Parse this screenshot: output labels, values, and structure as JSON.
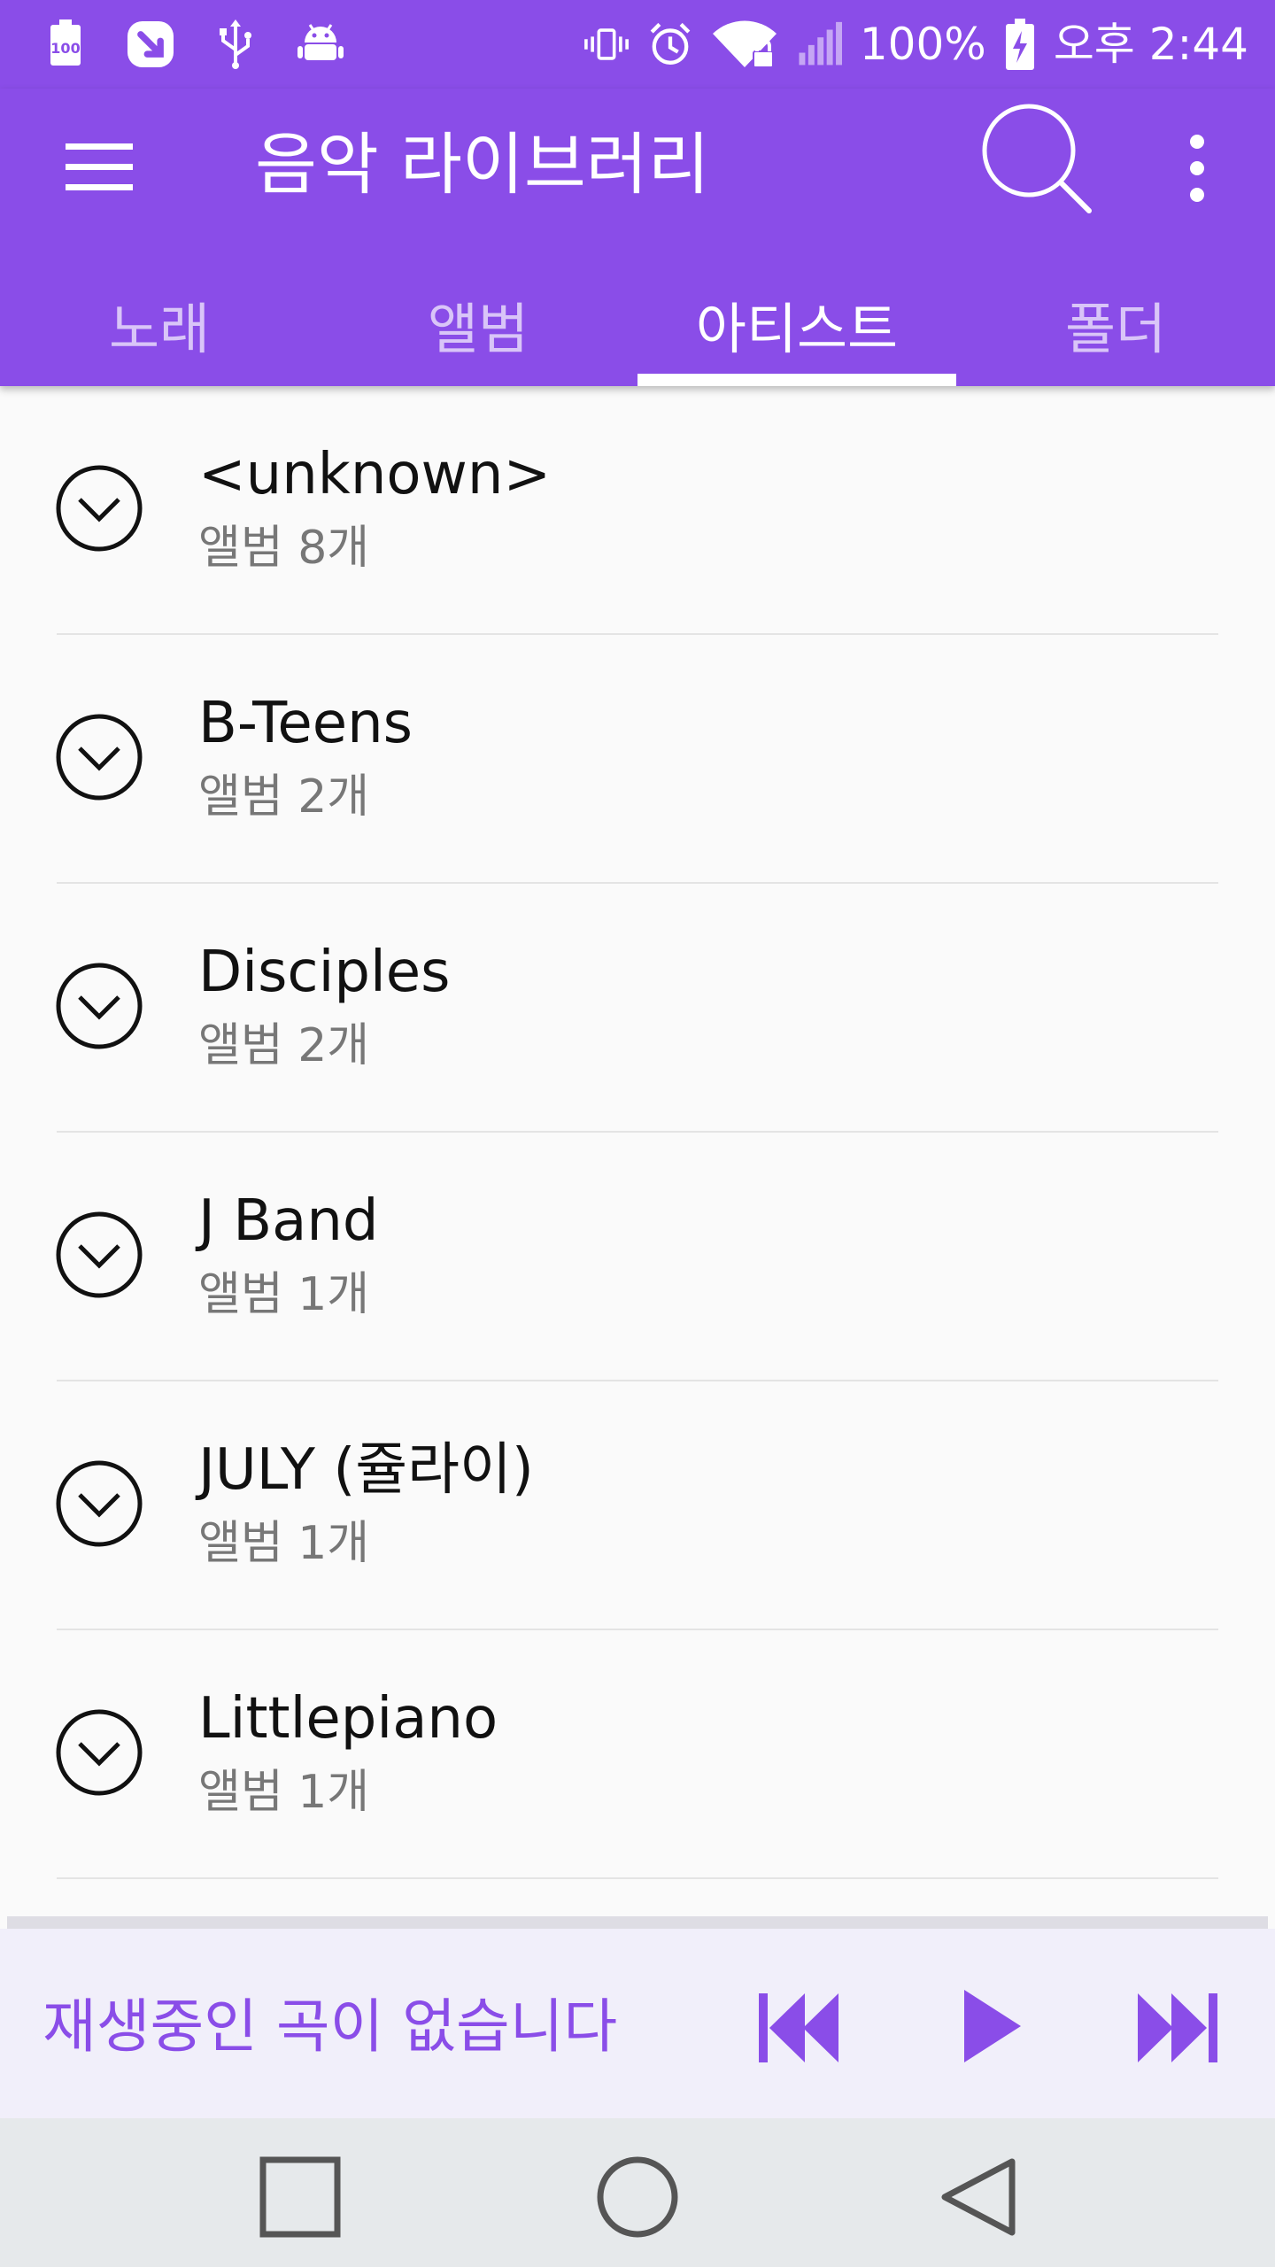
{
  "status_bar": {
    "left_icons": [
      "battery-100-notification-icon",
      "app-notification-icon",
      "usb-icon",
      "android-debug-icon"
    ],
    "right_icons": [
      "vibrate-icon",
      "alarm-icon",
      "wifi-locked-icon",
      "signal-icon"
    ],
    "battery_percent": "100%",
    "time": "오후 2:44"
  },
  "app_bar": {
    "title": "음악 라이브러리",
    "accent_color": "#8a4de8"
  },
  "tabs": [
    {
      "label": "노래",
      "active": false
    },
    {
      "label": "앨범",
      "active": false
    },
    {
      "label": "아티스트",
      "active": true
    },
    {
      "label": "폴더",
      "active": false
    }
  ],
  "artists": [
    {
      "name": "<unknown>",
      "albums": "앨범 8개"
    },
    {
      "name": "B-Teens",
      "albums": "앨범 2개"
    },
    {
      "name": "Disciples",
      "albums": "앨범 2개"
    },
    {
      "name": "J Band",
      "albums": "앨범 1개"
    },
    {
      "name": "JULY (쥴라이)",
      "albums": "앨범 1개"
    },
    {
      "name": "Littlepiano",
      "albums": "앨범 1개"
    }
  ],
  "player": {
    "status_text": "재생중인 곡이 없습니다"
  }
}
